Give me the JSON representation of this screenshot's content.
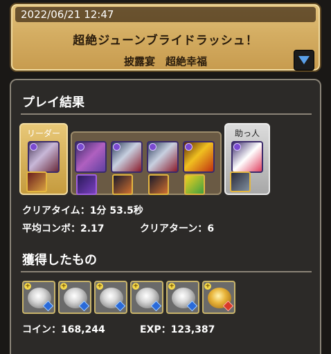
{
  "header": {
    "datetime": "2022/06/21 12:47",
    "dungeon_title": "超絶ジューンブライドラッシュ！",
    "floor_name": "披露宴　超絶幸福",
    "dropdown_icon": "triangle-down-icon"
  },
  "play_result": {
    "section_title": "プレイ結果",
    "leader_label": "リーダー",
    "helper_label": "助っ人",
    "clear_time_label": "クリアタイム：",
    "clear_time_value": "1分 53.5秒",
    "avg_combo_label": "平均コンボ：",
    "avg_combo_value": "2.17",
    "clear_turn_label": "クリアターン：",
    "clear_turn_value": "6"
  },
  "rewards": {
    "section_title": "獲得したもの",
    "drops": [
      {
        "name": "silver-flower-icon"
      },
      {
        "name": "silver-flower-icon"
      },
      {
        "name": "silver-flower-icon"
      },
      {
        "name": "silver-flower-icon"
      },
      {
        "name": "silver-flower-icon"
      },
      {
        "name": "gold-flower-icon"
      }
    ],
    "coin_label": "コイン：",
    "coin_value": "168,244",
    "exp_label": "EXP：",
    "exp_value": "123,387"
  },
  "colors": {
    "header_gold": "#d4ad62",
    "panel_bg": "#2c2a28",
    "leader_frame": "#e8c878",
    "helper_frame": "#dcdcdc",
    "dropdown_arrow": "#5aa0e8"
  }
}
